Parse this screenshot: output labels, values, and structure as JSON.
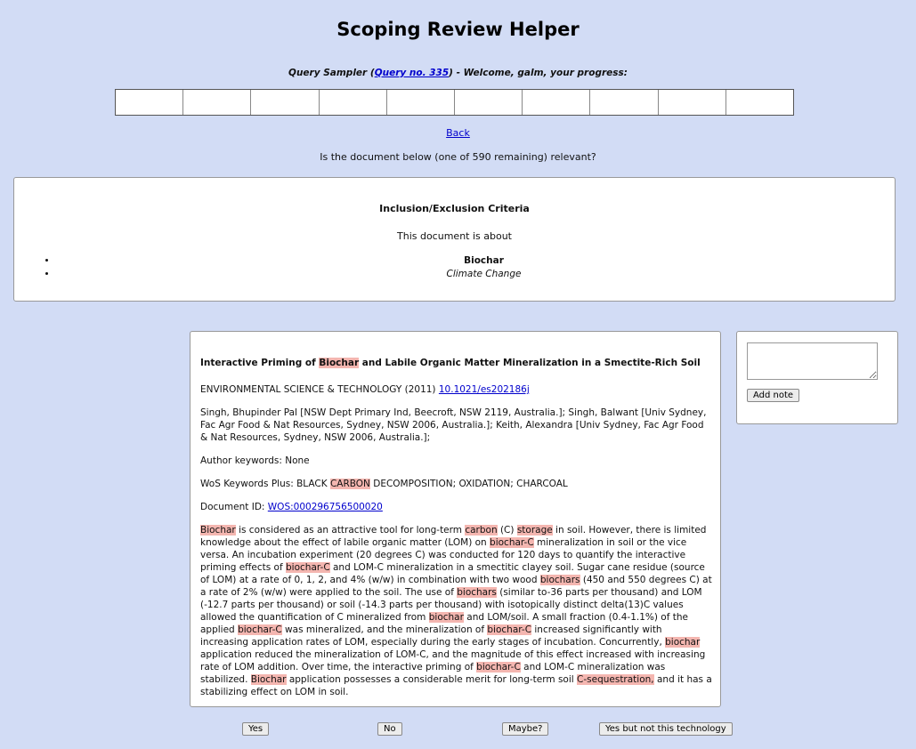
{
  "app": {
    "title": "Scoping Review Helper"
  },
  "sampler": {
    "prefix": "Query Sampler (",
    "query_link": "Query no. 335",
    "suffix": ") - Welcome, galm, your progress:"
  },
  "progress": {
    "segments": 10,
    "completed_fraction": 0.0
  },
  "nav": {
    "back_label": "Back"
  },
  "question": "Is the document below (one of 590 remaining) relevant?",
  "criteria": {
    "heading": "Inclusion/Exclusion Criteria",
    "about": "This document is about",
    "items": [
      "Biochar",
      "Climate Change"
    ]
  },
  "document": {
    "title_parts": [
      "Interactive Priming of ",
      "Biochar",
      " and Labile Organic Matter Mineralization in a Smectite-Rich Soil"
    ],
    "journal": "ENVIRONMENTAL SCIENCE & TECHNOLOGY (2011) ",
    "doi": "10.1021/es202186j",
    "authors": "Singh, Bhupinder Pal [NSW Dept Primary Ind, Beecroft, NSW 2119, Australia.]; Singh, Balwant [Univ Sydney, Fac Agr Food & Nat Resources, Sydney, NSW 2006, Australia.]; Keith, Alexandra [Univ Sydney, Fac Agr Food & Nat Resources, Sydney, NSW 2006, Australia.];",
    "author_keywords": "Author keywords: None",
    "wos_keywords_parts": [
      "WoS Keywords Plus: BLACK ",
      "CARBON",
      " DECOMPOSITION; OXIDATION; CHARCOAL"
    ],
    "doc_id_label": "Document ID: ",
    "doc_id": "WOS:000296756500020",
    "abstract": [
      {
        "t": "Biochar",
        "h": true
      },
      {
        "t": " is considered as an attractive tool for long-term ",
        "h": false
      },
      {
        "t": "carbon",
        "h": true
      },
      {
        "t": " (C) ",
        "h": false
      },
      {
        "t": "storage",
        "h": true
      },
      {
        "t": " in soil. However, there is limited knowledge about the effect of labile organic matter (LOM) on ",
        "h": false
      },
      {
        "t": "biochar-C",
        "h": true
      },
      {
        "t": " mineralization in soil or the vice versa. An incubation experiment (20 degrees C) was conducted for 120 days to quantify the interactive priming effects of ",
        "h": false
      },
      {
        "t": "biochar-C",
        "h": true
      },
      {
        "t": " and LOM-C mineralization in a smectitic clayey soil. Sugar cane residue (source of LOM) at a rate of 0, 1, 2, and 4% (w/w) in combination with two wood ",
        "h": false
      },
      {
        "t": "biochars",
        "h": true
      },
      {
        "t": " (450 and 550 degrees C) at a rate of 2% (w/w) were applied to the soil. The use of ",
        "h": false
      },
      {
        "t": "biochars",
        "h": true
      },
      {
        "t": " (similar to-36 parts per thousand) and LOM (-12.7 parts per thousand) or soil (-14.3 parts per thousand) with isotopically distinct delta(13)C values allowed the quantification of C mineralized from ",
        "h": false
      },
      {
        "t": "biochar",
        "h": true
      },
      {
        "t": " and LOM/soil. A small fraction (0.4-1.1%) of the applied ",
        "h": false
      },
      {
        "t": "biochar-C",
        "h": true
      },
      {
        "t": " was mineralized, and the mineralization of ",
        "h": false
      },
      {
        "t": "biochar-C",
        "h": true
      },
      {
        "t": " increased significantly with increasing application rates of LOM, especially during the early stages of incubation. Concurrently, ",
        "h": false
      },
      {
        "t": "biochar",
        "h": true
      },
      {
        "t": " application reduced the mineralization of LOM-C, and the magnitude of this effect increased with increasing rate of LOM addition. Over time, the interactive priming of ",
        "h": false
      },
      {
        "t": "biochar-C",
        "h": true
      },
      {
        "t": " and LOM-C mineralization was stabilized. ",
        "h": false
      },
      {
        "t": "Biochar",
        "h": true
      },
      {
        "t": " application possesses a considerable merit for long-term soil ",
        "h": false
      },
      {
        "t": "C-sequestration,",
        "h": true
      },
      {
        "t": " and it has a stabilizing effect on LOM in soil.",
        "h": false
      }
    ]
  },
  "notes": {
    "add_label": "Add note",
    "value": ""
  },
  "actions": {
    "yes": "Yes",
    "no": "No",
    "maybe": "Maybe?",
    "yes_not_tech": "Yes but not this technology"
  },
  "colors": {
    "background": "#d2dcf5",
    "highlight": "#f4b6b0",
    "link": "#0000cc"
  }
}
